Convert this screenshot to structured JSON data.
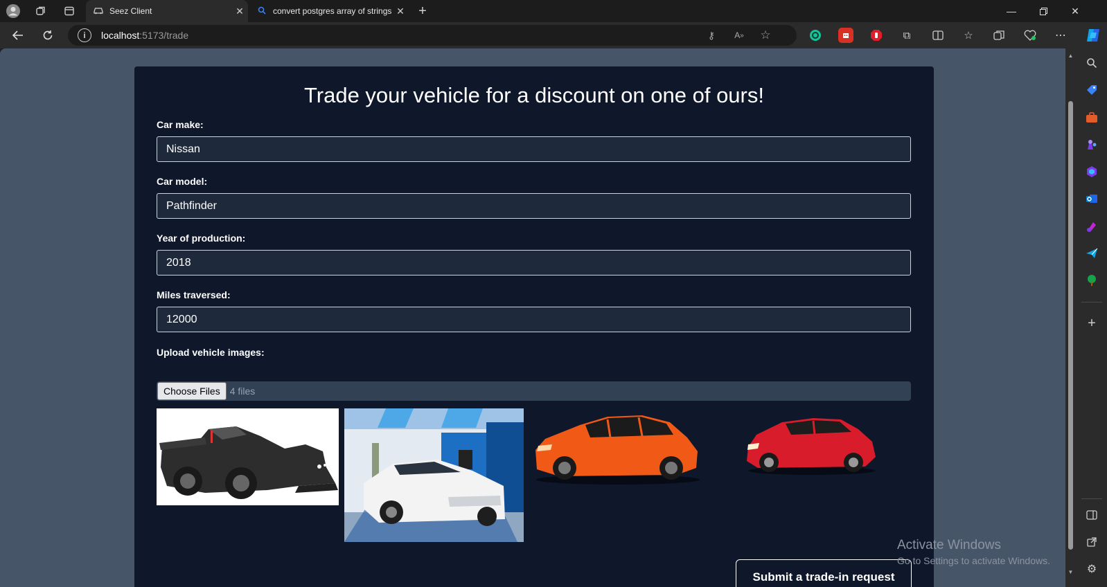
{
  "browser": {
    "tabs": [
      {
        "title": "Seez Client",
        "favicon": "car-icon",
        "active": true
      },
      {
        "title": "convert postgres array of strings",
        "favicon": "search-icon",
        "active": false
      }
    ],
    "url_host": "localhost",
    "url_path": ":5173/trade"
  },
  "page": {
    "title": "Trade your vehicle for a discount on one of ours!",
    "fields": {
      "make": {
        "label": "Car make:",
        "value": "Nissan"
      },
      "model": {
        "label": "Car model:",
        "value": "Pathfinder"
      },
      "year": {
        "label": "Year of production:",
        "value": "2018"
      },
      "miles": {
        "label": "Miles traversed:",
        "value": "12000"
      }
    },
    "upload": {
      "label": "Upload vehicle images:",
      "button": "Choose Files",
      "status": "4 files"
    },
    "images": [
      {
        "name": "black-race-car",
        "color": "#2d2d2d"
      },
      {
        "name": "white-toyota-mirai",
        "color": "#e8e8e8"
      },
      {
        "name": "orange-hatchback",
        "color": "#f15a16"
      },
      {
        "name": "red-hatchback",
        "color": "#d91c2b"
      }
    ],
    "submit": "Submit a trade-in request"
  },
  "watermark": {
    "line1": "Activate Windows",
    "line2": "Go to Settings to activate Windows."
  },
  "colors": {
    "page_bg": "#475569",
    "card_bg": "#0f172a",
    "input_bg": "#1e293b"
  }
}
